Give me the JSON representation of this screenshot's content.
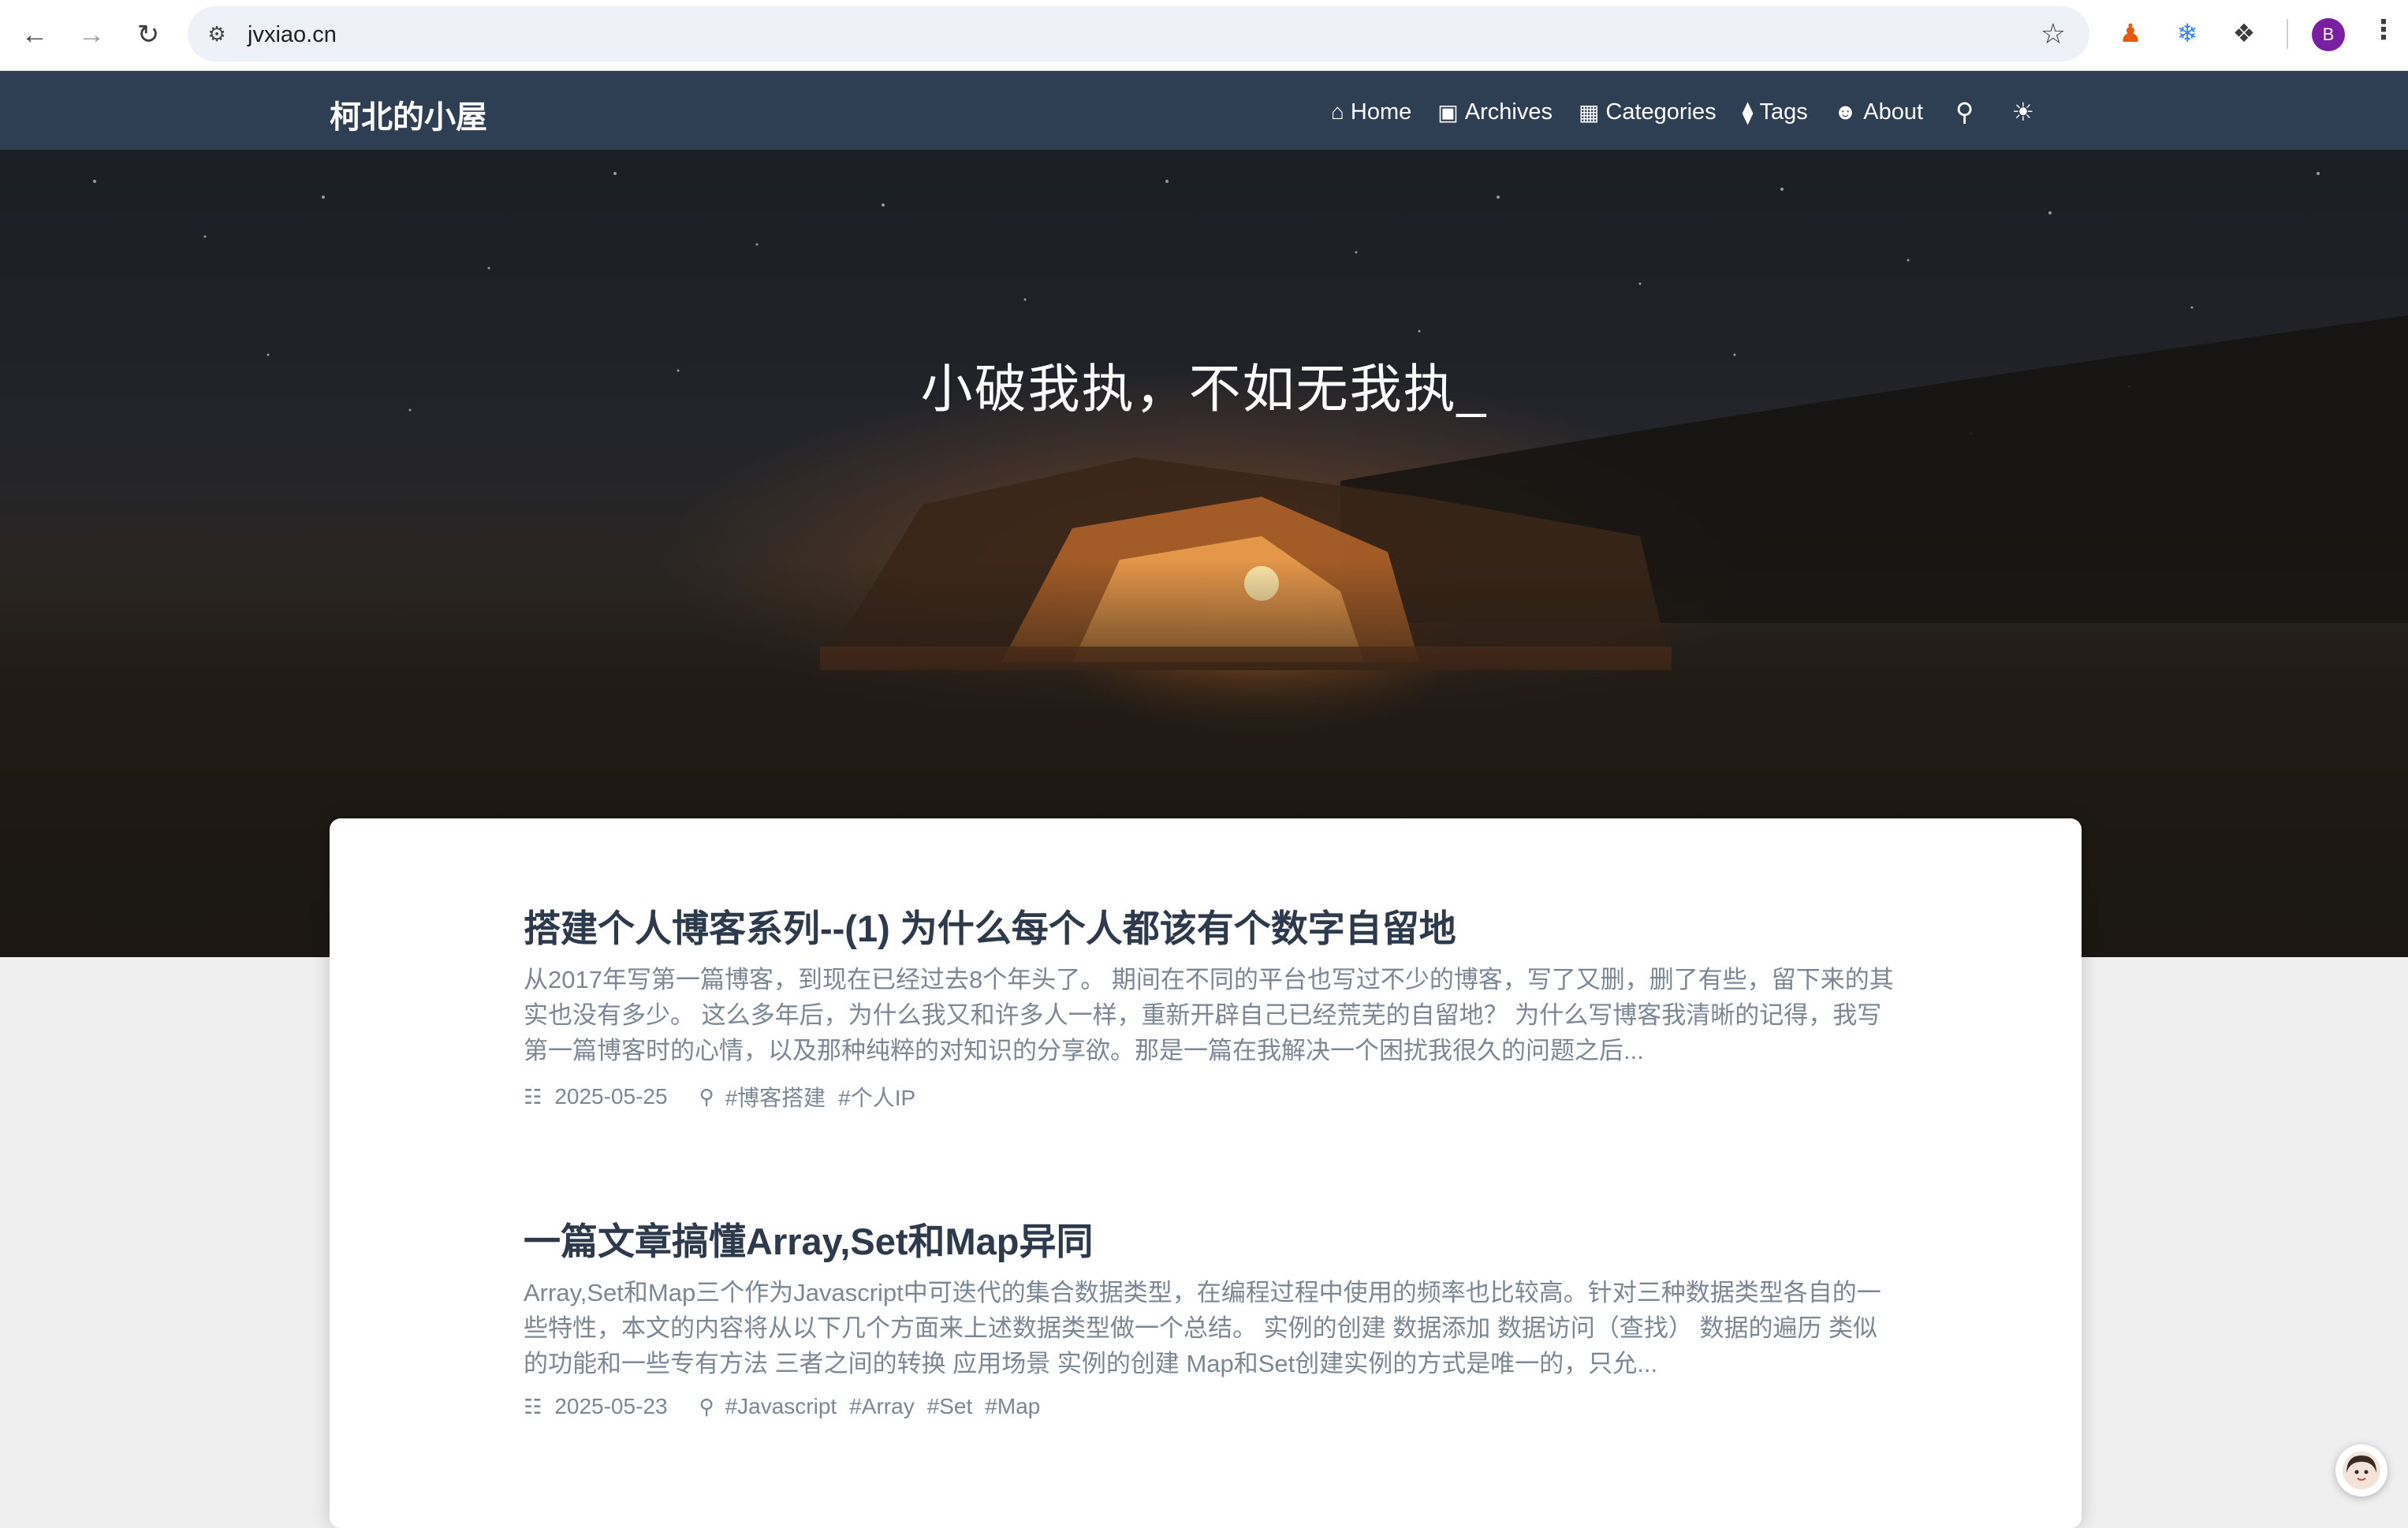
{
  "browser": {
    "url": "jvxiao.cn",
    "profile_initial": "B"
  },
  "site": {
    "brand": "柯北的小屋",
    "nav": [
      {
        "label": "Home",
        "icon": "home-icon"
      },
      {
        "label": "Archives",
        "icon": "archive-icon"
      },
      {
        "label": "Categories",
        "icon": "categories-icon"
      },
      {
        "label": "Tags",
        "icon": "tags-icon"
      },
      {
        "label": "About",
        "icon": "user-icon"
      }
    ]
  },
  "hero": {
    "title": "小破我执，不如无我执_"
  },
  "posts": [
    {
      "title": "搭建个人博客系列--(1) 为什么每个人都该有个数字自留地",
      "excerpt": "从2017年写第一篇博客，到现在已经过去8个年头了。 期间在不同的平台也写过不少的博客，写了又删，删了有些，留下来的其实也没有多少。 这么多年后，为什么我又和许多人一样，重新开辟自己已经荒芜的自留地？ 为什么写博客我清晰的记得，我写第一篇博客时的心情，以及那种纯粹的对知识的分享欲。那是一篇在我解决一个困扰我很久的问题之后...",
      "date": "2025-05-25",
      "tags": [
        "#博客搭建",
        "#个人IP"
      ]
    },
    {
      "title": "一篇文章搞懂Array,Set和Map异同",
      "excerpt": "Array,Set和Map三个作为Javascript中可迭代的集合数据类型，在编程过程中使用的频率也比较高。针对三种数据类型各自的一些特性，本文的内容将从以下几个方面来上述数据类型做一个总结。 实例的创建 数据添加 数据访问（查找） 数据的遍历 类似的功能和一些专有方法 三者之间的转换 应用场景 实例的创建 Map和Set创建实例的方式是唯一的，只允...",
      "date": "2025-05-23",
      "tags": [
        "#Javascript",
        "#Array",
        "#Set",
        "#Map"
      ]
    }
  ]
}
